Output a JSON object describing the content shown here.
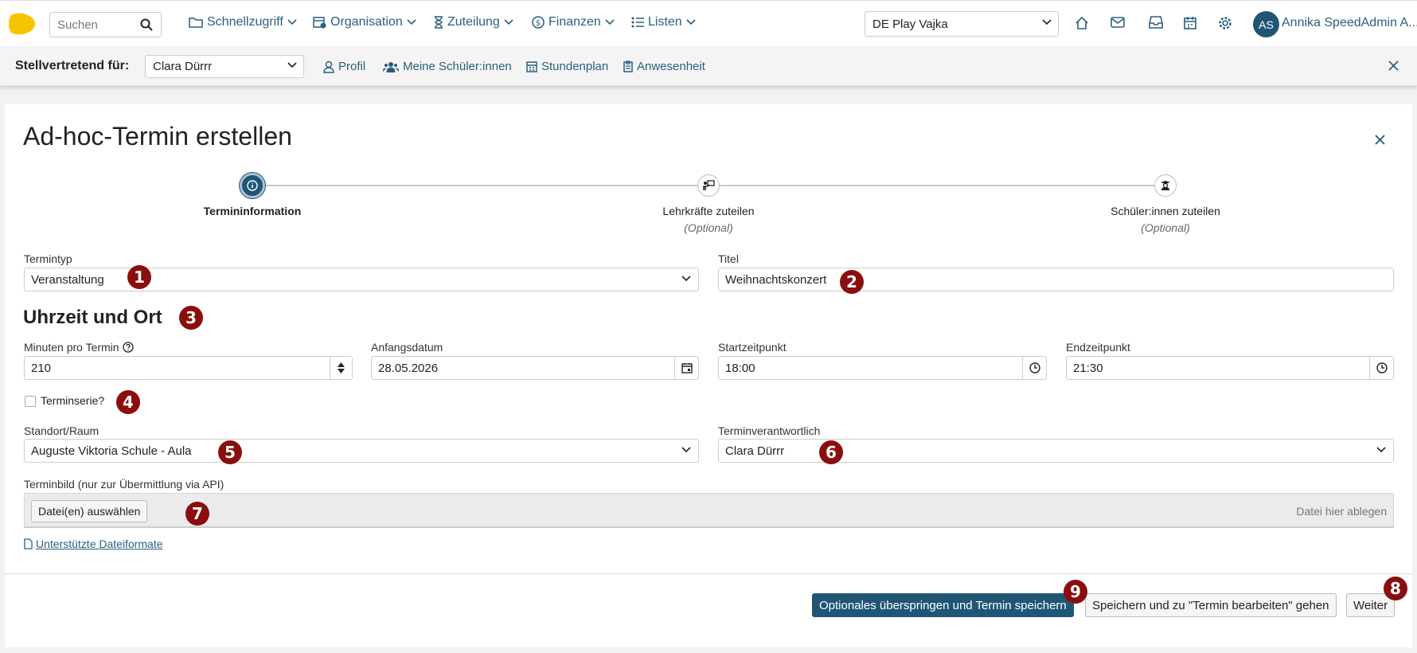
{
  "topnav": {
    "search_placeholder": "Suchen",
    "menus": [
      "Schnellzugriff",
      "Organisation",
      "Zuteilung",
      "Finanzen",
      "Listen"
    ],
    "school_select": "DE Play Vajka",
    "avatar_initials": "AS",
    "user_name": "Annika SpeedAdmin A...",
    "icons": [
      "home-icon",
      "mail-icon",
      "inbox-icon",
      "calendar-icon",
      "settings-icon"
    ]
  },
  "deputy": {
    "label": "Stellvertretend für:",
    "selected": "Clara Dürrr",
    "links": [
      "Profil",
      "Meine Schüler:innen",
      "Stundenplan",
      "Anwesenheit"
    ]
  },
  "modal": {
    "title": "Ad-hoc-Termin erstellen",
    "steps": [
      {
        "label": "Termininformation",
        "sub": ""
      },
      {
        "label": "Lehrkräfte zuteilen",
        "sub": "(Optional)"
      },
      {
        "label": "Schüler:innen zuteilen",
        "sub": "(Optional)"
      }
    ],
    "fields": {
      "termintyp_label": "Termintyp",
      "termintyp_value": "Veranstaltung",
      "titel_label": "Titel",
      "titel_value": "Weihnachtskonzert",
      "section_heading": "Uhrzeit und Ort",
      "minuten_label": "Minuten pro Termin",
      "minuten_value": "210",
      "anfangsdatum_label": "Anfangsdatum",
      "anfangsdatum_value": "28.05.2026",
      "startzeit_label": "Startzeitpunkt",
      "startzeit_value": "18:00",
      "endzeit_label": "Endzeitpunkt",
      "endzeit_value": "21:30",
      "terminserie_label": "Terminserie?",
      "standort_label": "Standort/Raum",
      "standort_value": "Auguste Viktoria Schule - Aula",
      "verantwortlich_label": "Terminverantwortlich",
      "verantwortlich_value": "Clara Dürrr",
      "bild_label": "Terminbild (nur zur Übermittlung via API)",
      "bild_button": "Datei(en) auswählen",
      "bild_hint": "Datei hier ablegen",
      "formats_link": " Unterstützte Dateiformate"
    },
    "buttons": {
      "skip_save": "Optionales überspringen und Termin speichern",
      "save_edit": "Speichern und zu \"Termin bearbeiten\" gehen",
      "next": "Weiter"
    }
  },
  "badges": [
    "1",
    "2",
    "3",
    "4",
    "5",
    "6",
    "7",
    "8",
    "9"
  ],
  "colors": {
    "accent": "#1f5675",
    "link": "#2b5f7e",
    "badge": "#8b0e0e",
    "logo": "#f5c400"
  }
}
